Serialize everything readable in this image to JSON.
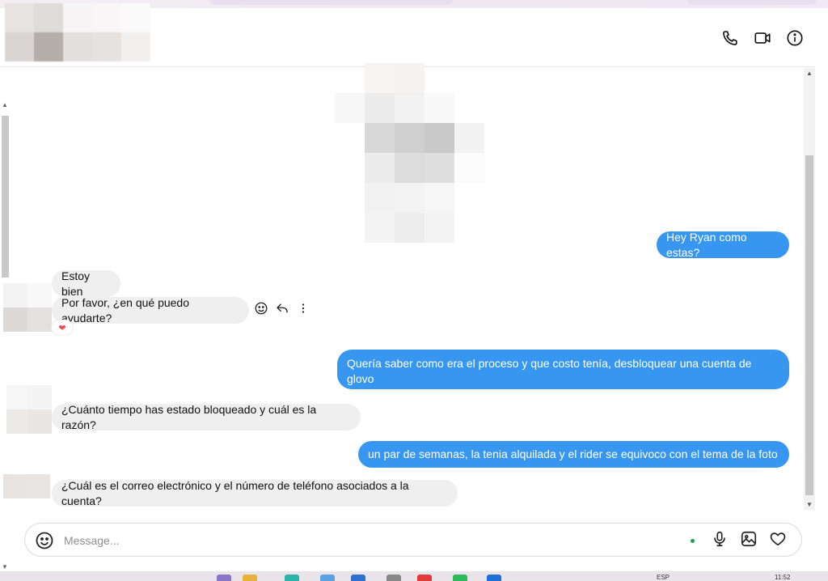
{
  "header": {
    "icons": [
      "phone-icon",
      "video-camera-icon",
      "info-icon"
    ]
  },
  "messages": [
    {
      "id": "m1",
      "direction": "outgoing",
      "text": "Hey Ryan como estas?"
    },
    {
      "id": "m2",
      "direction": "incoming",
      "text": "Estoy bien"
    },
    {
      "id": "m3",
      "direction": "incoming",
      "text": "Por favor, ¿en qué puedo ayudarte?",
      "reaction": "heart-icon"
    },
    {
      "id": "m4",
      "direction": "outgoing",
      "text": "Quería saber como era el proceso y que costo tenía, desbloquear una cuenta de glovo"
    },
    {
      "id": "m5",
      "direction": "incoming",
      "text": "¿Cuánto tiempo has estado bloqueado y cuál es la razón?"
    },
    {
      "id": "m6",
      "direction": "outgoing",
      "text": "un par de semanas, la tenia alquilada y el rider se equivoco con el tema de la foto"
    },
    {
      "id": "m7",
      "direction": "incoming",
      "text": "¿Cuál es el correo electrónico y el número de teléfono asociados a la cuenta?"
    }
  ],
  "message_actions": [
    "smiley-icon",
    "reply-icon",
    "more-options-icon"
  ],
  "composer": {
    "placeholder": "Message...",
    "value": "",
    "icons": [
      "emoji-icon",
      "microphone-icon",
      "image-icon",
      "heart-icon"
    ]
  },
  "taskbar": {
    "language": "ESP",
    "time": "11:52"
  },
  "colors": {
    "outgoing_bubble": "#3797f0",
    "incoming_bubble": "#efefef",
    "reaction_heart": "#ed4956",
    "online_dot": "#1e9e5e"
  }
}
